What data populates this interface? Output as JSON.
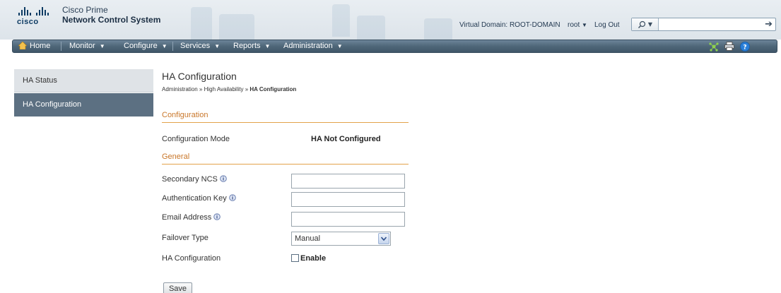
{
  "brand": {
    "logo_text": "cisco",
    "line1": "Cisco Prime",
    "line2": "Network Control System"
  },
  "header": {
    "virtual_domain": "Virtual Domain: ROOT-DOMAIN",
    "user": "root",
    "logout": "Log Out",
    "search_placeholder": ""
  },
  "nav": {
    "home": "Home",
    "monitor": "Monitor",
    "configure": "Configure",
    "services": "Services",
    "reports": "Reports",
    "administration": "Administration"
  },
  "sidebar": {
    "items": [
      {
        "label": "HA Status"
      },
      {
        "label": "HA Configuration"
      }
    ]
  },
  "page": {
    "title": "HA Configuration",
    "breadcrumb": {
      "part1": "Administration",
      "part2": "High Availability",
      "current": "HA Configuration"
    }
  },
  "sections": {
    "configuration": "Configuration",
    "general": "General"
  },
  "form": {
    "config_mode_label": "Configuration Mode",
    "config_mode_value": "HA Not Configured",
    "secondary_ncs_label": "Secondary NCS",
    "secondary_ncs_value": "",
    "auth_key_label": "Authentication Key",
    "auth_key_value": "",
    "email_label": "Email Address",
    "email_value": "",
    "failover_label": "Failover Type",
    "failover_value": "Manual",
    "ha_config_label": "HA Configuration",
    "enable_label": "Enable",
    "enable_checked": false,
    "save_label": "Save"
  },
  "colors": {
    "nav_bg": "#4f6779",
    "sidebar_active": "#5c7082",
    "section_accent": "#e3a24a",
    "section_text": "#c9772a"
  }
}
